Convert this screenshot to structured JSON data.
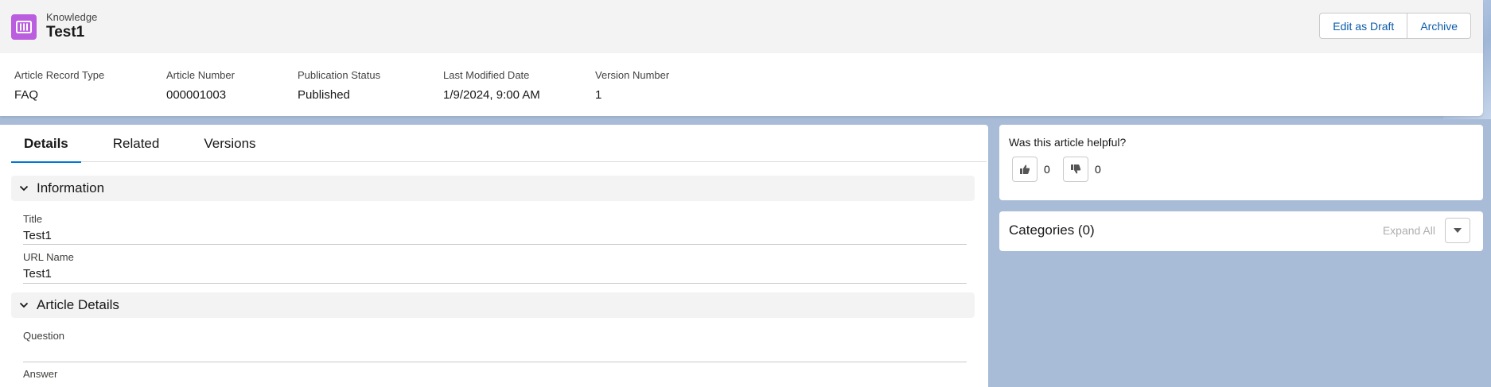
{
  "header": {
    "object_type": "Knowledge",
    "record_name": "Test1",
    "icon": "knowledge-book-icon",
    "icon_color": "#bb5ddf",
    "actions": {
      "edit_as_draft": "Edit as Draft",
      "archive": "Archive"
    }
  },
  "highlights": [
    {
      "label": "Article Record Type",
      "value": "FAQ"
    },
    {
      "label": "Article Number",
      "value": "000001003"
    },
    {
      "label": "Publication Status",
      "value": "Published"
    },
    {
      "label": "Last Modified Date",
      "value": "1/9/2024, 9:00 AM"
    },
    {
      "label": "Version Number",
      "value": "1"
    }
  ],
  "tabs": [
    {
      "label": "Details",
      "active": true
    },
    {
      "label": "Related",
      "active": false
    },
    {
      "label": "Versions",
      "active": false
    }
  ],
  "sections": {
    "information": {
      "title": "Information",
      "fields": [
        {
          "label": "Title",
          "value": "Test1"
        },
        {
          "label": "URL Name",
          "value": "Test1"
        }
      ]
    },
    "article_details": {
      "title": "Article Details",
      "fields": [
        {
          "label": "Question",
          "value": ""
        },
        {
          "label": "Answer",
          "value": ""
        }
      ]
    }
  },
  "feedback": {
    "title": "Was this article helpful?",
    "upvotes": "0",
    "downvotes": "0"
  },
  "categories": {
    "title": "Categories (0)",
    "expand_all": "Expand All"
  },
  "colors": {
    "accent": "#0176d3",
    "link": "#0b5cab",
    "background": "#a9bcd7"
  }
}
